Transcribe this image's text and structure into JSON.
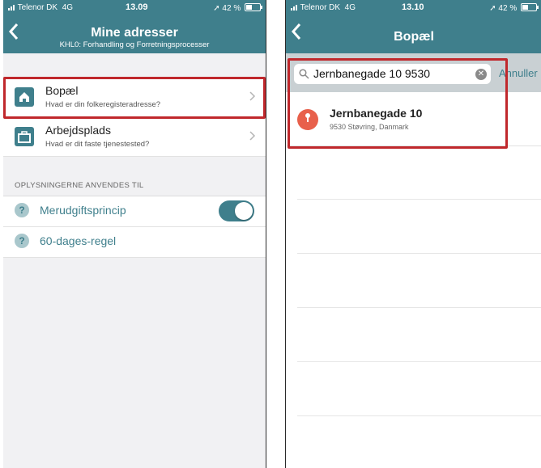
{
  "left_screen": {
    "status": {
      "carrier": "Telenor DK",
      "network": "4G",
      "time": "13.09",
      "battery": "42 %",
      "battery_level": 0.42
    },
    "header": {
      "title": "Mine adresser",
      "subtitle": "KHL0: Forhandling og Forretningsprocesser",
      "back_icon": "chevron-left-icon"
    },
    "address_items": [
      {
        "title": "Bopæl",
        "subtitle": "Hvad er din folkeregisteradresse?",
        "icon": "house-icon"
      },
      {
        "title": "Arbejdsplads",
        "subtitle": "Hvad er dit faste tjenestested?",
        "icon": "briefcase-icon"
      }
    ],
    "section_header": "OPLYSNINGERNE ANVENDES TIL",
    "info_items": [
      {
        "label": "Merudgiftsprincip",
        "icon": "question-icon",
        "toggle_on": true
      },
      {
        "label": "60-dages-regel",
        "icon": "question-icon"
      }
    ],
    "highlight_color": "#c0282c"
  },
  "right_screen": {
    "status": {
      "carrier": "Telenor DK",
      "network": "4G",
      "time": "13.10",
      "battery": "42 %",
      "battery_level": 0.42
    },
    "header": {
      "title": "Bopæl",
      "back_icon": "chevron-left-icon"
    },
    "search": {
      "value": "Jernbanegade 10 9530",
      "cancel_label": "Annuller"
    },
    "result": {
      "title": "Jernbanegade 10",
      "subtitle": "9530 Støvring, Danmark",
      "icon": "map-pin-icon"
    }
  },
  "colors": {
    "accent": "#3f7f8c",
    "highlight": "#c0282c",
    "pin": "#e8604b"
  }
}
